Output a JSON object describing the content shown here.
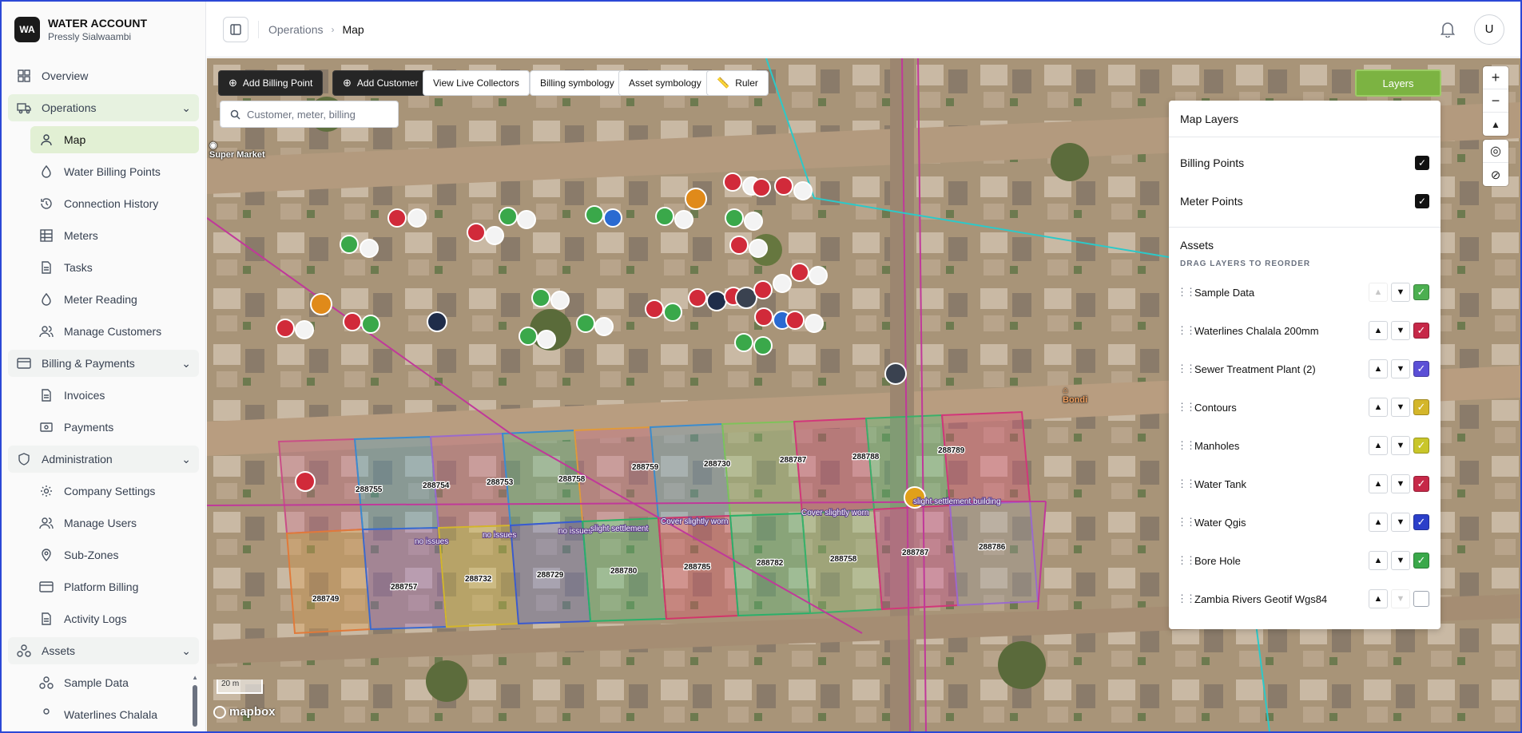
{
  "brand": {
    "initials": "WA",
    "name": "WATER ACCOUNT",
    "user": "Pressly Sialwaambi"
  },
  "sidebar": {
    "overview": "Overview",
    "operations": {
      "label": "Operations",
      "items": [
        "Map",
        "Water Billing Points",
        "Connection History",
        "Meters",
        "Tasks",
        "Meter Reading",
        "Manage Customers"
      ]
    },
    "billing": {
      "label": "Billing & Payments",
      "items": [
        "Invoices",
        "Payments"
      ]
    },
    "administration": {
      "label": "Administration",
      "items": [
        "Company Settings",
        "Manage Users",
        "Sub-Zones",
        "Platform Billing",
        "Activity Logs"
      ]
    },
    "assets": {
      "label": "Assets",
      "items": [
        "Sample Data",
        "Waterlines Chalala"
      ]
    }
  },
  "breadcrumb": {
    "parent": "Operations",
    "current": "Map"
  },
  "user_avatar": "U",
  "toolbar": {
    "add_billing_point": "Add Billing Point",
    "add_customer": "Add Customer",
    "view_live_collectors": "View Live Collectors",
    "billing_symbology": "Billing symbology",
    "asset_symbology": "Asset symbology",
    "ruler": "Ruler",
    "layers": "Layers"
  },
  "search": {
    "placeholder": "Customer, meter, billing",
    "value": ""
  },
  "map": {
    "poi_super_market": "Super Market",
    "poi_bondi": "Bondi",
    "scale": "20 m",
    "attribution": "mapbox",
    "parcel_labels": [
      "288755",
      "288754",
      "288753",
      "288758",
      "288759",
      "288730",
      "288787",
      "288788",
      "288789",
      "288749",
      "288757",
      "288732",
      "288729",
      "288780",
      "288785",
      "288782",
      "288758",
      "288787",
      "288786"
    ],
    "status_labels": [
      "no issues",
      "Cover slightly worn",
      "slight settlement",
      "slight settlement building"
    ]
  },
  "layers_panel": {
    "title": "Map Layers",
    "billing_points": {
      "label": "Billing Points",
      "checked": true
    },
    "meter_points": {
      "label": "Meter Points",
      "checked": true
    },
    "assets_title": "Assets",
    "drag_hint": "DRAG LAYERS TO REORDER",
    "layers": [
      {
        "name": "Sample Data",
        "color": "#4caf50",
        "checked": true
      },
      {
        "name": "Waterlines Chalala 200mm",
        "color": "#c62848",
        "checked": true
      },
      {
        "name": "Sewer Treatment Plant (2)",
        "color": "#5b4fd6",
        "checked": true
      },
      {
        "name": "Contours",
        "color": "#d4b62a",
        "checked": true
      },
      {
        "name": "Manholes",
        "color": "#c9c62a",
        "checked": true
      },
      {
        "name": "Water Tank",
        "color": "#c62848",
        "checked": true
      },
      {
        "name": "Water Qgis",
        "color": "#2b3fc9",
        "checked": true
      },
      {
        "name": "Bore Hole",
        "color": "#3aa84a",
        "checked": true
      },
      {
        "name": "Zambia Rivers Geotif Wgs84",
        "color": "#ffffff",
        "checked": false
      }
    ]
  },
  "accent": "#7cb342"
}
